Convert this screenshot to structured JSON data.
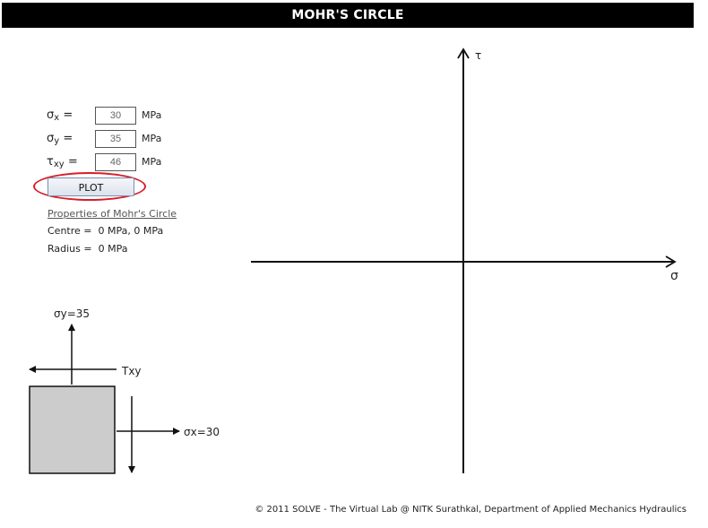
{
  "header": {
    "title": "MOHR'S CIRCLE"
  },
  "inputs": [
    {
      "symbol": "σ",
      "subscript": "x",
      "value": "30",
      "unit": "MPa"
    },
    {
      "symbol": "σ",
      "subscript": "y",
      "value": "35",
      "unit": "MPa"
    },
    {
      "symbol": "τ",
      "subscript": "xy",
      "value": "46",
      "unit": "MPa"
    }
  ],
  "equals": "=",
  "plot_button": "PLOT",
  "properties": {
    "link": "Properties of Mohr's Circle",
    "centre_label": "Centre =",
    "centre_value": "0 MPa, 0 MPa",
    "radius_label": "Radius =",
    "radius_value": "0 MPa"
  },
  "stress_element": {
    "sigma_y_label": "σy=35",
    "tau_label": "Txy",
    "sigma_x_label": "σx=30",
    "fill_color": "#cccccc"
  },
  "plot_axes": {
    "x_label": "σ",
    "y_label": "τ"
  },
  "footer": "© 2011 SOLVE - The Virtual Lab @ NITK Surathkal, Department of Applied Mechanics Hydraulics",
  "colors": {
    "title_bg": "#000000",
    "highlight_ring": "#d81e2a"
  }
}
